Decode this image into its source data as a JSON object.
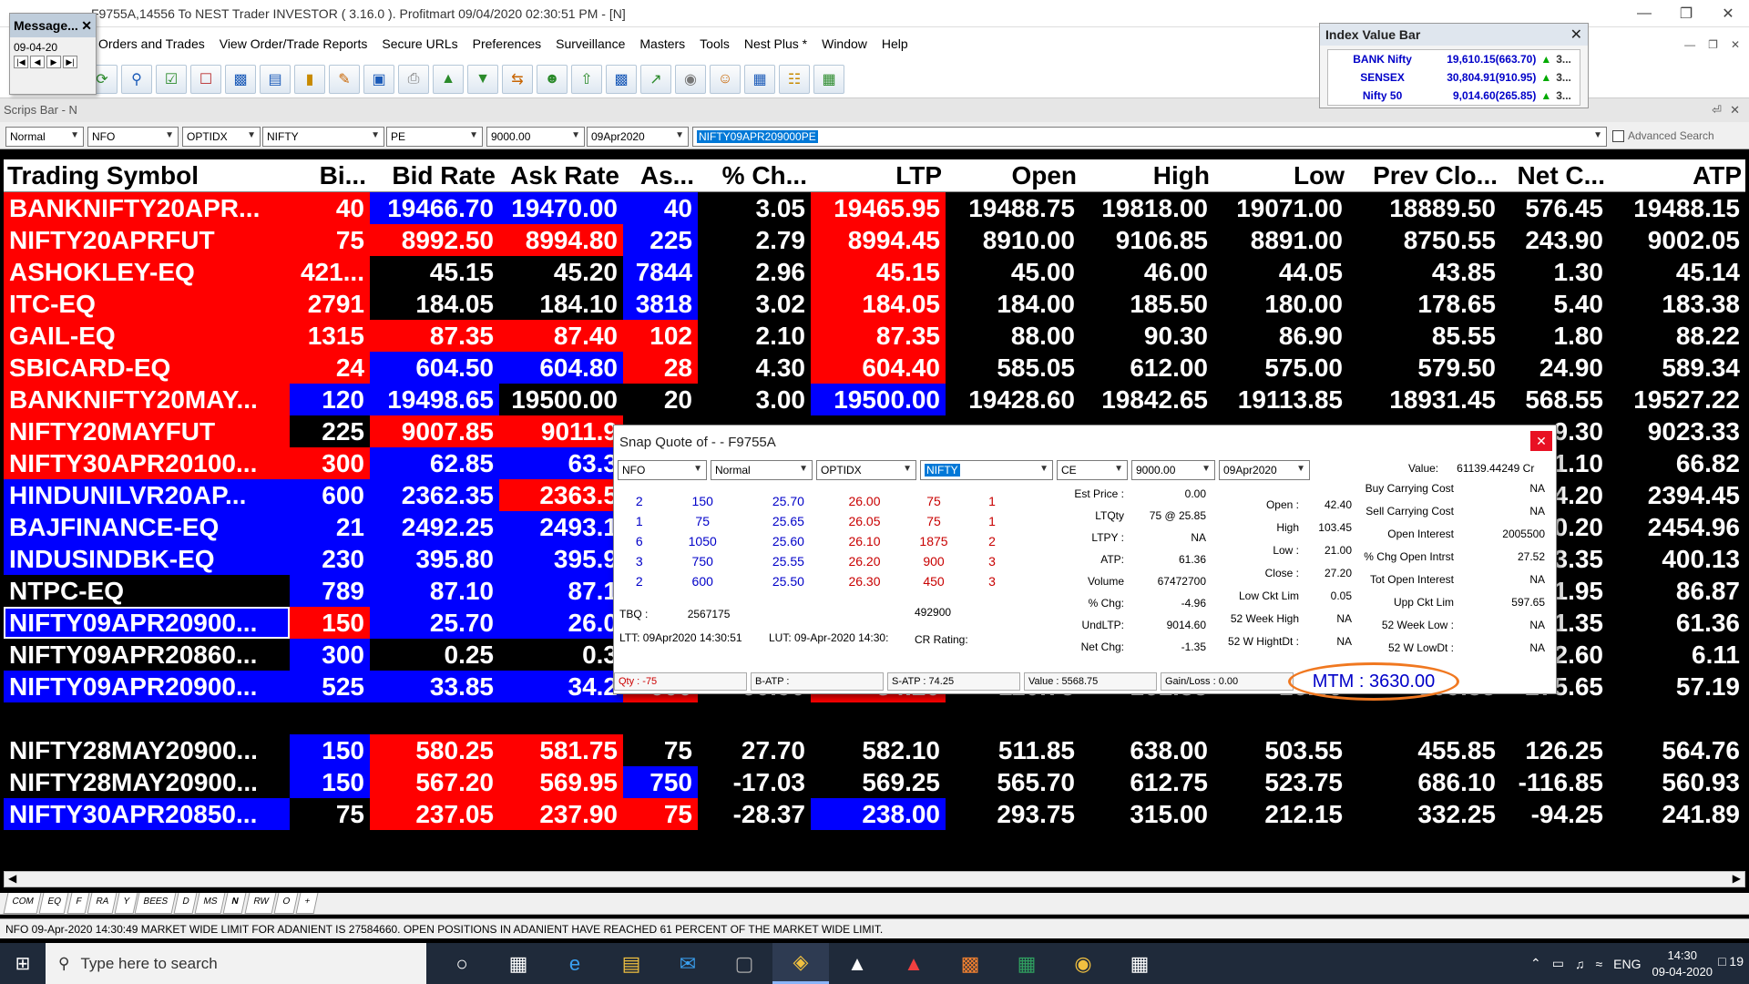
{
  "window": {
    "title": "F9755A,14556 To NEST Trader INVESTOR ( 3.16.0 ). Profitmart 09/04/2020 02:30:51 PM - [N]"
  },
  "menu": [
    "Orders and Trades",
    "View Order/Trade Reports",
    "Secure URLs",
    "Preferences",
    "Surveillance",
    "Masters",
    "Tools",
    "Nest Plus *",
    "Window",
    "Help"
  ],
  "message_window": {
    "title": "Message...",
    "date": "09-04-20"
  },
  "index_bar": {
    "title": "Index Value Bar",
    "rows": [
      {
        "name": "BANK Nifty",
        "value": "19,610.15(663.70)",
        "more": "3..."
      },
      {
        "name": "SENSEX",
        "value": "30,804.91(910.95)",
        "more": "3..."
      },
      {
        "name": "Nifty 50",
        "value": "9,014.60(265.85)",
        "more": "3..."
      }
    ]
  },
  "scrips_bar": {
    "title": "Scrips Bar - N",
    "fields": {
      "order_type": "Normal",
      "exchange": "NFO",
      "instrument": "OPTIDX",
      "symbol": "NIFTY",
      "opt_type": "PE",
      "strike": "9000.00",
      "expiry": "09Apr2020",
      "scrip": "NIFTY09APR209000PE"
    },
    "advanced_search": "Advanced Search"
  },
  "market_watch": {
    "columns": [
      "Trading Symbol",
      "Bi...",
      "Bid Rate",
      "Ask Rate",
      "As...",
      "% Ch...",
      "LTP",
      "Open",
      "High",
      "Low",
      "Prev Clo...",
      "Net C...",
      "ATP"
    ],
    "rows": [
      {
        "cells": [
          "BANKNIFTY20APR...",
          "40",
          "19466.70",
          "19470.00",
          "40",
          "3.05",
          "19465.95",
          "19488.75",
          "19818.00",
          "19071.00",
          "18889.50",
          "576.45",
          "19488.15"
        ],
        "colors": [
          "r",
          "r",
          "b",
          "b",
          "b",
          "k",
          "r",
          "k",
          "k",
          "k",
          "k",
          "k",
          "k"
        ]
      },
      {
        "cells": [
          "NIFTY20APRFUT",
          "75",
          "8992.50",
          "8994.80",
          "225",
          "2.79",
          "8994.45",
          "8910.00",
          "9106.85",
          "8891.00",
          "8750.55",
          "243.90",
          "9002.05"
        ],
        "colors": [
          "r",
          "r",
          "r",
          "r",
          "b",
          "k",
          "r",
          "k",
          "k",
          "k",
          "k",
          "k",
          "k"
        ]
      },
      {
        "cells": [
          "ASHOKLEY-EQ",
          "421...",
          "45.15",
          "45.20",
          "7844",
          "2.96",
          "45.15",
          "45.00",
          "46.00",
          "44.05",
          "43.85",
          "1.30",
          "45.14"
        ],
        "colors": [
          "r",
          "r",
          "k",
          "k",
          "b",
          "k",
          "r",
          "k",
          "k",
          "k",
          "k",
          "k",
          "k"
        ]
      },
      {
        "cells": [
          "ITC-EQ",
          "2791",
          "184.05",
          "184.10",
          "3818",
          "3.02",
          "184.05",
          "184.00",
          "185.50",
          "180.00",
          "178.65",
          "5.40",
          "183.38"
        ],
        "colors": [
          "r",
          "r",
          "k",
          "k",
          "b",
          "k",
          "r",
          "k",
          "k",
          "k",
          "k",
          "k",
          "k"
        ]
      },
      {
        "cells": [
          "GAIL-EQ",
          "1315",
          "87.35",
          "87.40",
          "102",
          "2.10",
          "87.35",
          "88.00",
          "90.30",
          "86.90",
          "85.55",
          "1.80",
          "88.22"
        ],
        "colors": [
          "r",
          "r",
          "r",
          "r",
          "r",
          "k",
          "r",
          "k",
          "k",
          "k",
          "k",
          "k",
          "k"
        ]
      },
      {
        "cells": [
          "SBICARD-EQ",
          "24",
          "604.50",
          "604.80",
          "28",
          "4.30",
          "604.40",
          "585.05",
          "612.00",
          "575.00",
          "579.50",
          "24.90",
          "589.34"
        ],
        "colors": [
          "r",
          "r",
          "b",
          "b",
          "r",
          "k",
          "r",
          "k",
          "k",
          "k",
          "k",
          "k",
          "k"
        ]
      },
      {
        "cells": [
          "BANKNIFTY20MAY...",
          "120",
          "19498.65",
          "19500.00",
          "20",
          "3.00",
          "19500.00",
          "19428.60",
          "19842.65",
          "19113.85",
          "18931.45",
          "568.55",
          "19527.22"
        ],
        "colors": [
          "r",
          "b",
          "b",
          "k",
          "k",
          "k",
          "b",
          "k",
          "k",
          "k",
          "k",
          "k",
          "k"
        ]
      },
      {
        "cells": [
          "NIFTY20MAYFUT",
          "225",
          "9007.85",
          "9011.9",
          "",
          "",
          "",
          "",
          "",
          "",
          "",
          "9.30",
          "9023.33"
        ],
        "colors": [
          "r",
          "k",
          "r",
          "r",
          "k",
          "k",
          "k",
          "k",
          "k",
          "k",
          "k",
          "k",
          "k"
        ]
      },
      {
        "cells": [
          "NIFTY30APR20100...",
          "300",
          "62.85",
          "63.3",
          "",
          "",
          "",
          "",
          "",
          "",
          "",
          "1.10",
          "66.82"
        ],
        "colors": [
          "r",
          "r",
          "b",
          "b",
          "k",
          "k",
          "k",
          "k",
          "k",
          "k",
          "k",
          "k",
          "k"
        ]
      },
      {
        "cells": [
          "HINDUNILVR20AP...",
          "600",
          "2362.35",
          "2363.5",
          "",
          "",
          "",
          "",
          "",
          "",
          "",
          "4.20",
          "2394.45"
        ],
        "colors": [
          "b",
          "b",
          "b",
          "r",
          "k",
          "k",
          "k",
          "k",
          "k",
          "k",
          "k",
          "k",
          "k"
        ]
      },
      {
        "cells": [
          "BAJFINANCE-EQ",
          "21",
          "2492.25",
          "2493.1",
          "",
          "",
          "",
          "",
          "",
          "",
          "",
          "0.20",
          "2454.96"
        ],
        "colors": [
          "b",
          "b",
          "b",
          "b",
          "k",
          "k",
          "k",
          "k",
          "k",
          "k",
          "k",
          "k",
          "k"
        ]
      },
      {
        "cells": [
          "INDUSINDBK-EQ",
          "230",
          "395.80",
          "395.9",
          "",
          "",
          "",
          "",
          "",
          "",
          "",
          "3.35",
          "400.13"
        ],
        "colors": [
          "b",
          "b",
          "b",
          "b",
          "k",
          "k",
          "k",
          "k",
          "k",
          "k",
          "k",
          "k",
          "k"
        ]
      },
      {
        "cells": [
          "NTPC-EQ",
          "789",
          "87.10",
          "87.1",
          "",
          "",
          "",
          "",
          "",
          "",
          "",
          "1.95",
          "86.87"
        ],
        "colors": [
          "k",
          "b",
          "b",
          "b",
          "k",
          "k",
          "k",
          "k",
          "k",
          "k",
          "k",
          "k",
          "k"
        ]
      },
      {
        "cells": [
          "NIFTY09APR20900...",
          "150",
          "25.70",
          "26.0",
          "",
          "",
          "",
          "",
          "",
          "",
          "",
          "-1.35",
          "61.36"
        ],
        "colors": [
          "b",
          "r",
          "b",
          "b",
          "k",
          "k",
          "k",
          "k",
          "k",
          "k",
          "k",
          "k",
          "k"
        ],
        "selected": true
      },
      {
        "cells": [
          "NIFTY09APR20860...",
          "300",
          "0.25",
          "0.3",
          "",
          "",
          "",
          "",
          "",
          "",
          "",
          "2.60",
          "6.11"
        ],
        "colors": [
          "k",
          "b",
          "k",
          "k",
          "k",
          "k",
          "k",
          "k",
          "k",
          "k",
          "k",
          "k",
          "k"
        ]
      },
      {
        "cells": [
          "NIFTY09APR20900...",
          "525",
          "33.85",
          "34.2",
          "600",
          "-60.90",
          "34.20",
          "110.75",
          "161.85",
          "16.80",
          "309.85",
          "-275.65",
          "57.19"
        ],
        "colors": [
          "b",
          "b",
          "b",
          "b",
          "r",
          "k",
          "r",
          "k",
          "k",
          "k",
          "k",
          "k",
          "k"
        ]
      },
      {
        "cells": [
          "",
          "",
          "",
          "",
          "",
          "",
          "",
          "",
          "",
          "",
          "",
          "",
          ""
        ],
        "colors": [
          "k",
          "k",
          "k",
          "k",
          "k",
          "k",
          "k",
          "k",
          "k",
          "k",
          "k",
          "k",
          "k"
        ]
      },
      {
        "cells": [
          "NIFTY28MAY20900...",
          "150",
          "580.25",
          "581.75",
          "75",
          "27.70",
          "582.10",
          "511.85",
          "638.00",
          "503.55",
          "455.85",
          "126.25",
          "564.76"
        ],
        "colors": [
          "k",
          "b",
          "r",
          "r",
          "k",
          "k",
          "k",
          "k",
          "k",
          "k",
          "k",
          "k",
          "k"
        ]
      },
      {
        "cells": [
          "NIFTY28MAY20900...",
          "150",
          "567.20",
          "569.95",
          "750",
          "-17.03",
          "569.25",
          "565.70",
          "612.75",
          "523.75",
          "686.10",
          "-116.85",
          "560.93"
        ],
        "colors": [
          "k",
          "b",
          "r",
          "r",
          "b",
          "k",
          "k",
          "k",
          "k",
          "k",
          "k",
          "k",
          "k"
        ]
      },
      {
        "cells": [
          "NIFTY30APR20850...",
          "75",
          "237.05",
          "237.90",
          "75",
          "-28.37",
          "238.00",
          "293.75",
          "315.00",
          "212.15",
          "332.25",
          "-94.25",
          "241.89"
        ],
        "colors": [
          "b",
          "k",
          "r",
          "r",
          "r",
          "k",
          "b",
          "k",
          "k",
          "k",
          "k",
          "k",
          "k"
        ]
      }
    ]
  },
  "snap_quote": {
    "title": "Snap Quote of  - - F9755A",
    "filters": {
      "exchange": "NFO",
      "order_type": "Normal",
      "instrument": "OPTIDX",
      "symbol": "NIFTY",
      "opt_type": "CE",
      "strike": "9000.00",
      "expiry": "09Apr2020"
    },
    "value_label": "Value:",
    "value": "61139.44249 Cr",
    "buy_depth": [
      [
        "2",
        "150",
        "25.70"
      ],
      [
        "1",
        "75",
        "25.65"
      ],
      [
        "6",
        "1050",
        "25.60"
      ],
      [
        "3",
        "750",
        "25.55"
      ],
      [
        "2",
        "600",
        "25.50"
      ]
    ],
    "sell_depth": [
      [
        "26.00",
        "75",
        "1"
      ],
      [
        "26.05",
        "75",
        "1"
      ],
      [
        "26.10",
        "1875",
        "2"
      ],
      [
        "26.20",
        "900",
        "3"
      ],
      [
        "26.30",
        "450",
        "3"
      ]
    ],
    "tbq_label": "TBQ :",
    "tbq": "2567175",
    "tsq": "492900",
    "ltt_label": "LTT:",
    "ltt": "09Apr2020 14:30:51",
    "lut_label": "LUT:",
    "lut": "09-Apr-2020 14:30:",
    "cr_rating_label": "CR Rating:",
    "col1": [
      {
        "label": "Est Price :",
        "value": "0.00"
      },
      {
        "label": "LTQty",
        "value": "75 @ 25.85"
      },
      {
        "label": "LTPY :",
        "value": "NA"
      },
      {
        "label": "ATP:",
        "value": "61.36"
      },
      {
        "label": "Volume",
        "value": "67472700"
      },
      {
        "label": "% Chg:",
        "value": "-4.96"
      },
      {
        "label": "UndLTP:",
        "value": "9014.60"
      },
      {
        "label": "Net Chg:",
        "value": "-1.35"
      }
    ],
    "col2": [
      {
        "label": "Open :",
        "value": "42.40"
      },
      {
        "label": "High",
        "value": "103.45"
      },
      {
        "label": "Low :",
        "value": "21.00"
      },
      {
        "label": "Close :",
        "value": "27.20"
      },
      {
        "label": "Low Ckt Lim",
        "value": "0.05"
      },
      {
        "label": "52 Week High",
        "value": "NA"
      },
      {
        "label": "52 W HightDt :",
        "value": "NA"
      }
    ],
    "col3": [
      {
        "label": "Buy Carrying Cost",
        "value": "NA"
      },
      {
        "label": "Sell Carrying Cost",
        "value": "NA"
      },
      {
        "label": "Open Interest",
        "value": "2005500"
      },
      {
        "label": "% Chg Open Intrst",
        "value": "27.52"
      },
      {
        "label": "Tot Open Interest",
        "value": "NA"
      },
      {
        "label": "Upp Ckt Lim",
        "value": "597.65"
      },
      {
        "label": "52 Week Low :",
        "value": "NA"
      },
      {
        "label": "52 W LowDt :",
        "value": "NA"
      }
    ],
    "bottom": {
      "qty": "Qty : -75",
      "batp": "B-ATP :",
      "satp": "S-ATP : 74.25",
      "value": "Value : 5568.75",
      "gainloss": "Gain/Loss : 0.00",
      "mtm": "MTM : 3630.00"
    }
  },
  "tabs": [
    "COM",
    "EQ",
    "F",
    "RA",
    "Y",
    "BEES",
    "D",
    "MS",
    "N",
    "RW",
    "O",
    "+"
  ],
  "active_tab": "N",
  "status_message": "NFO 09-Apr-2020 14:30:49 MARKET WIDE LIMIT FOR ADANIENT IS 27584660. OPEN POSITIONS IN ADANIENT HAVE REACHED 61 PERCENT OF THE MARKET WIDE LIMIT.",
  "taskbar": {
    "search_placeholder": "Type here to search",
    "language": "ENG",
    "time": "14:30",
    "date": "09-04-2020",
    "notifications": "19"
  }
}
